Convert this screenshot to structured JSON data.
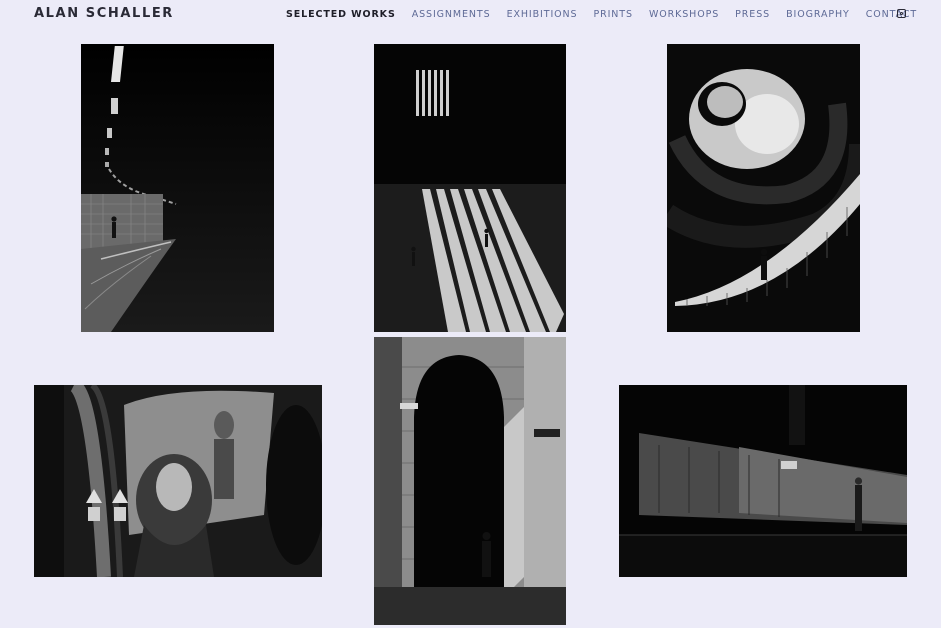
{
  "header": {
    "brand": "ALAN SCHALLER",
    "nav": [
      {
        "label": "SELECTED WORKS",
        "active": true
      },
      {
        "label": "ASSIGNMENTS"
      },
      {
        "label": "EXHIBITIONS"
      },
      {
        "label": "PRINTS"
      },
      {
        "label": "WORKSHOPS"
      },
      {
        "label": "PRESS"
      },
      {
        "label": "BIOGRAPHY"
      },
      {
        "label": "CONTACT"
      }
    ],
    "social_icon": "instagram-icon"
  },
  "gallery": {
    "photos": [
      {
        "name": "photo-underground-platform"
      },
      {
        "name": "photo-light-stripes-hall"
      },
      {
        "name": "photo-spiral-staircase"
      },
      {
        "name": "photo-train-window-portrait"
      },
      {
        "name": "photo-arched-doorway"
      },
      {
        "name": "photo-lit-street-wall"
      }
    ]
  },
  "colors": {
    "background": "#ecebf8",
    "nav_text": "#5e6a96",
    "nav_active": "#1e1e28",
    "brand": "#2a2a36"
  }
}
